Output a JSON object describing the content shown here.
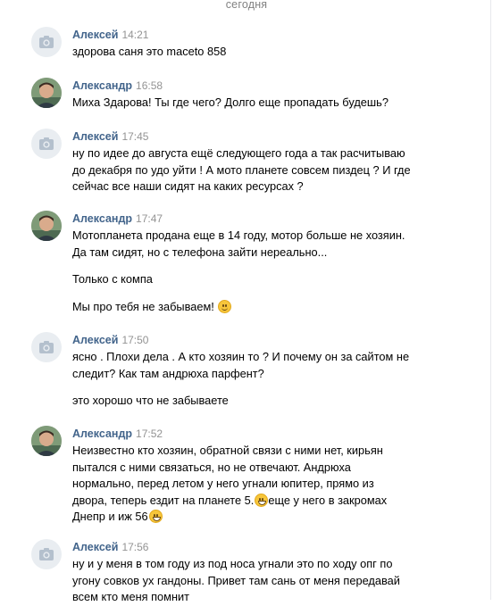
{
  "date_separator": "сегодня",
  "messages": [
    {
      "author": "Алексей",
      "time": "14:21",
      "avatar": "camera",
      "paragraphs": [
        [
          "здорова саня это maceto 858"
        ]
      ]
    },
    {
      "author": "Александр",
      "time": "16:58",
      "avatar": "photo",
      "paragraphs": [
        [
          "Миха Здарова! Ты где чего? Долго еще пропадать будешь?"
        ]
      ]
    },
    {
      "author": "Алексей",
      "time": "17:45",
      "avatar": "camera",
      "paragraphs": [
        [
          "ну по идее до августа ещё следующего года а так расчитываю",
          "до декабря по удо уйти ! А мото планете совсем пиздец ? И где",
          "сейчас все наши сидят на каких ресурсах ?"
        ]
      ]
    },
    {
      "author": "Александр",
      "time": "17:47",
      "avatar": "photo",
      "paragraphs": [
        [
          "Мотопланета продана еще в 14 году, мотор больше не хозяин.",
          "Да там сидят, но с телефона зайти нереально..."
        ],
        [
          "Только с компа"
        ],
        [
          "Мы про тебя не забываем! "
        ]
      ]
    },
    {
      "author": "Алексей",
      "time": "17:50",
      "avatar": "camera",
      "paragraphs": [
        [
          "ясно . Плохи дела . А кто хозяин то ? И почему он за сайтом не",
          "следит? Как там андрюха парфент?"
        ],
        [
          "это хорошо что не забываете"
        ]
      ]
    },
    {
      "author": "Александр",
      "time": "17:52",
      "avatar": "photo",
      "paragraphs": [
        [
          "Неизвестно кто хозяин, обратной связи с ними нет, кирьян",
          "пытался с ними связаться, но не отвечают. Андрюха",
          "нормально, перед летом у него угнали юпитер, прямо из",
          "двора, теперь ездит на планете 5.",
          "еще у него в закромах",
          "Днепр и иж 56"
        ]
      ]
    },
    {
      "author": "Алексей",
      "time": "17:56",
      "avatar": "camera",
      "paragraphs": [
        [
          "ну и у меня в том году из под носа угнали это по ходу опг по",
          "угону совков ух гандоны. Привет там сань от меня передавай",
          "всем кто меня помнит"
        ]
      ]
    }
  ],
  "colors": {
    "author": "#42648b",
    "time": "#939393",
    "separator": "#828282",
    "avatar_placeholder": "#e9edf1"
  },
  "icons": {
    "camera_avatar": "camera-icon",
    "smile": "smiling-face-emoji",
    "grin": "grinning-face-emoji"
  }
}
